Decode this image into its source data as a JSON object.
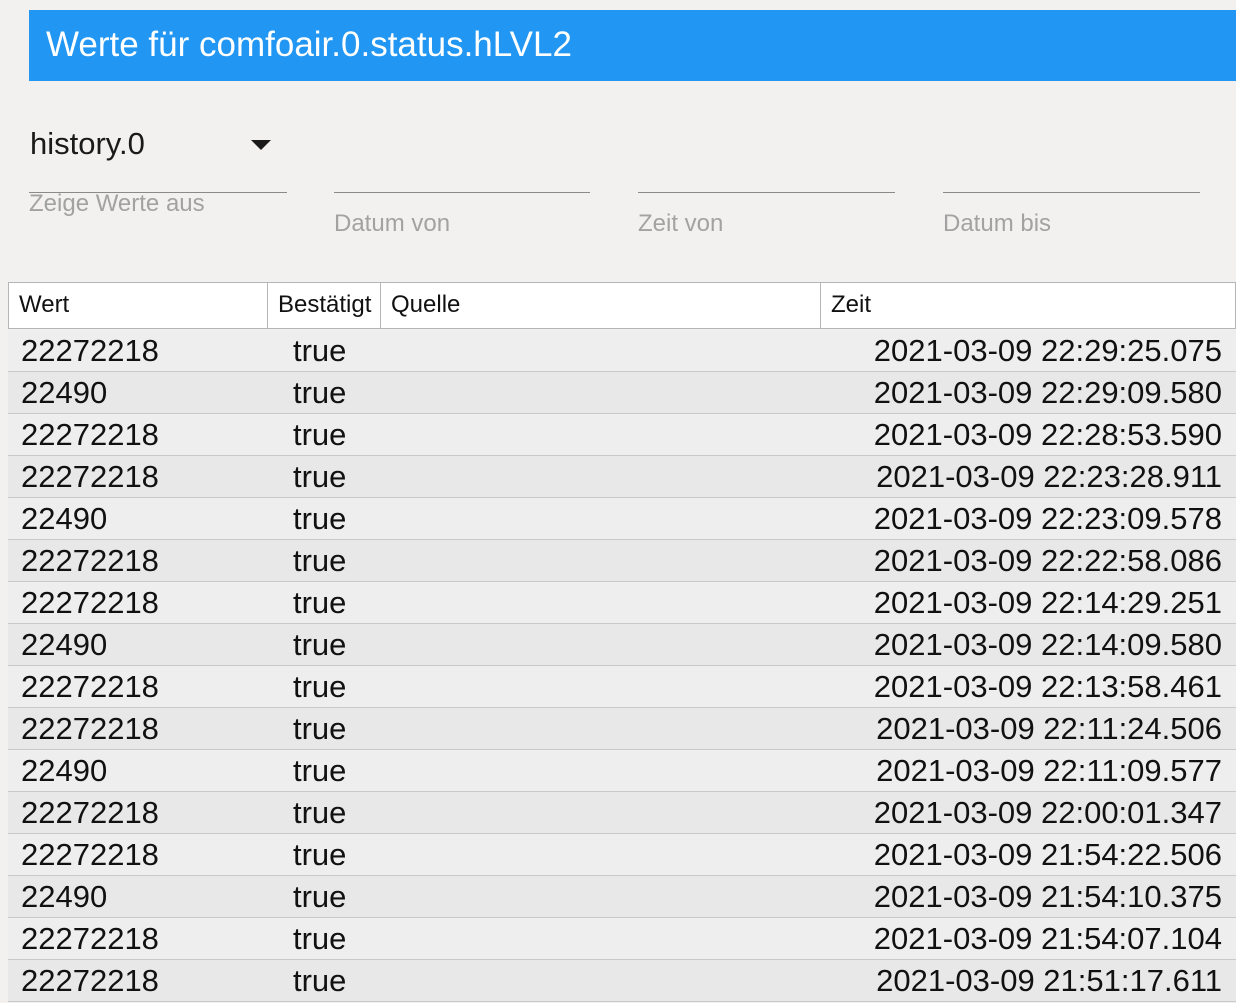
{
  "dialog": {
    "title": "Werte für comfoair.0.status.hLVL2"
  },
  "controls": {
    "instance": {
      "value": "history.0",
      "label": "Zeige Werte aus"
    },
    "date_from_label": "Datum von",
    "time_from_label": "Zeit von",
    "date_to_label": "Datum bis"
  },
  "table": {
    "columns": [
      "Wert",
      "Bestätigt",
      "Quelle",
      "Zeit"
    ],
    "rows": [
      {
        "val": "22272218",
        "ack": "true",
        "from": "",
        "ts": "2021-03-09 22:29:25.075"
      },
      {
        "val": "22490",
        "ack": "true",
        "from": "",
        "ts": "2021-03-09 22:29:09.580"
      },
      {
        "val": "22272218",
        "ack": "true",
        "from": "",
        "ts": "2021-03-09 22:28:53.590"
      },
      {
        "val": "22272218",
        "ack": "true",
        "from": "",
        "ts": "2021-03-09 22:23:28.911"
      },
      {
        "val": "22490",
        "ack": "true",
        "from": "",
        "ts": "2021-03-09 22:23:09.578"
      },
      {
        "val": "22272218",
        "ack": "true",
        "from": "",
        "ts": "2021-03-09 22:22:58.086"
      },
      {
        "val": "22272218",
        "ack": "true",
        "from": "",
        "ts": "2021-03-09 22:14:29.251"
      },
      {
        "val": "22490",
        "ack": "true",
        "from": "",
        "ts": "2021-03-09 22:14:09.580"
      },
      {
        "val": "22272218",
        "ack": "true",
        "from": "",
        "ts": "2021-03-09 22:13:58.461"
      },
      {
        "val": "22272218",
        "ack": "true",
        "from": "",
        "ts": "2021-03-09 22:11:24.506"
      },
      {
        "val": "22490",
        "ack": "true",
        "from": "",
        "ts": "2021-03-09 22:11:09.577"
      },
      {
        "val": "22272218",
        "ack": "true",
        "from": "",
        "ts": "2021-03-09 22:00:01.347"
      },
      {
        "val": "22272218",
        "ack": "true",
        "from": "",
        "ts": "2021-03-09 21:54:22.506"
      },
      {
        "val": "22490",
        "ack": "true",
        "from": "",
        "ts": "2021-03-09 21:54:10.375"
      },
      {
        "val": "22272218",
        "ack": "true",
        "from": "",
        "ts": "2021-03-09 21:54:07.104"
      },
      {
        "val": "22272218",
        "ack": "true",
        "from": "",
        "ts": "2021-03-09 21:51:17.611"
      }
    ]
  }
}
